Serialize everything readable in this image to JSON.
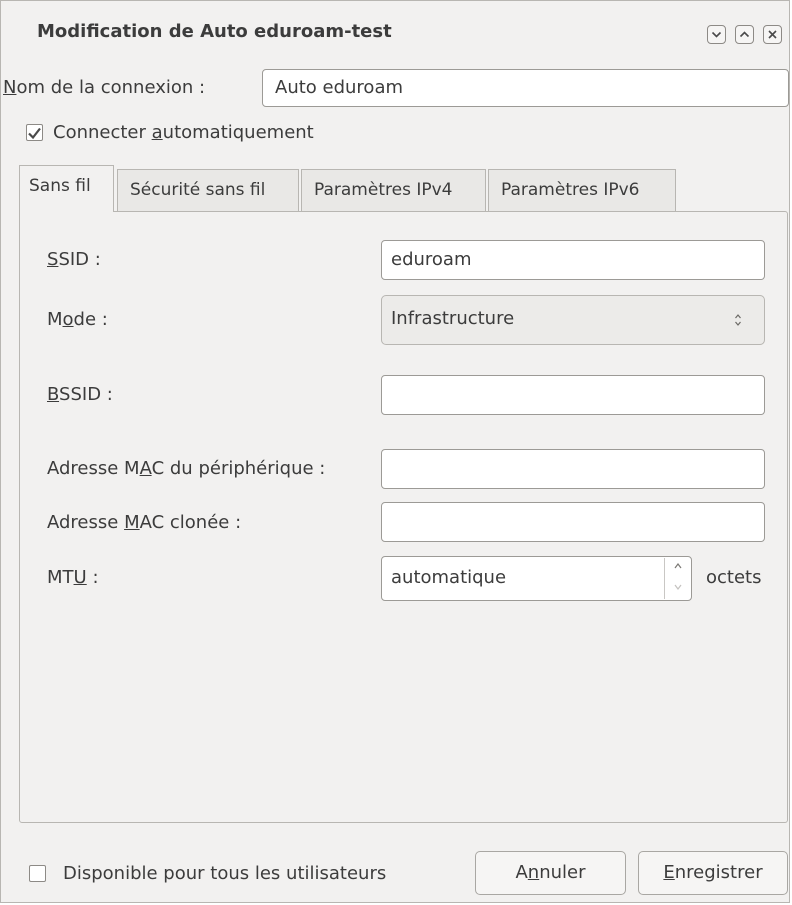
{
  "window": {
    "title": "Modification de Auto eduroam-test",
    "controls": [
      "minimize-icon",
      "maximize-icon",
      "close-icon"
    ]
  },
  "connection_name": {
    "label_first": "N",
    "label_rest": "om de la connexion :",
    "value": "Auto eduroam"
  },
  "auto_connect": {
    "checked": true,
    "label_pre": "Connecter ",
    "label_u": "a",
    "label_post": "utomatiquement"
  },
  "tabs": [
    {
      "label": "Sans fil",
      "active": true
    },
    {
      "label": "Sécurité sans fil",
      "active": false
    },
    {
      "label": "Paramètres IPv4",
      "active": false
    },
    {
      "label": "Paramètres IPv6",
      "active": false
    }
  ],
  "wifi": {
    "ssid": {
      "label_u": "S",
      "label_rest": "SID :",
      "value": "eduroam"
    },
    "mode": {
      "label_pre": "M",
      "label_u": "o",
      "label_post": "de :",
      "value": "Infrastructure"
    },
    "bssid": {
      "label_u": "B",
      "label_rest": "SSID :",
      "value": ""
    },
    "device_mac": {
      "label_pre": "Adresse M",
      "label_u": "A",
      "label_post": "C du périphérique :",
      "value": ""
    },
    "cloned_mac": {
      "label_pre": "Adresse ",
      "label_u": "M",
      "label_post": "AC clonée :",
      "value": ""
    },
    "mtu": {
      "label_pre": "MT",
      "label_u": "U",
      "label_post": " :",
      "value": "automatique",
      "unit": "octets"
    }
  },
  "footer": {
    "all_users": {
      "checked": false,
      "label": "Disponible pour tous les utilisateurs"
    },
    "cancel": {
      "pre": "A",
      "u": "n",
      "post": "nuler"
    },
    "save": {
      "u": "E",
      "post": "nregistrer"
    }
  },
  "colors": {
    "accent": "#3c3c3c",
    "check": "#4a4a4a"
  }
}
